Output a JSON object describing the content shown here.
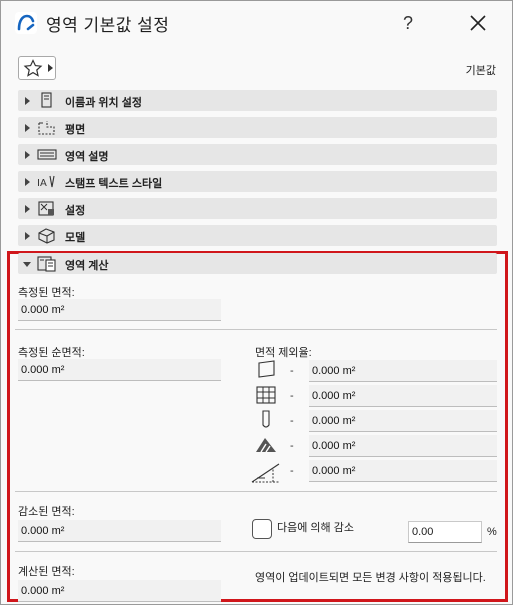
{
  "window": {
    "title": "영역 기본값 설정",
    "help_label": "?",
    "default_label": "기본값"
  },
  "favorites": {
    "icon": "star-icon"
  },
  "panels": [
    {
      "label": "이름과 위치 설정",
      "icon": "name-location-icon",
      "expanded": false
    },
    {
      "label": "평면",
      "icon": "floor-plan-icon",
      "expanded": false
    },
    {
      "label": "영역 설명",
      "icon": "description-icon",
      "expanded": false
    },
    {
      "label": "스탬프 텍스트 스타일",
      "icon": "stamp-text-icon",
      "expanded": false
    },
    {
      "label": "설정",
      "icon": "settings-icon",
      "expanded": false
    },
    {
      "label": "모델",
      "icon": "model-icon",
      "expanded": false
    },
    {
      "label": "영역 계산",
      "icon": "zone-calc-icon",
      "expanded": true
    }
  ],
  "calc": {
    "measured_label": "측정된 면적:",
    "measured_value": "0.000 m²",
    "net_label": "측정된 순면적:",
    "net_value": "0.000 m²",
    "deductions_label": "면적 제외율:",
    "deductions": [
      {
        "icon": "wall-icon",
        "dash": "-",
        "value": "0.000 m²"
      },
      {
        "icon": "column-grid-icon",
        "dash": "-",
        "value": "0.000 m²"
      },
      {
        "icon": "pillar-icon",
        "dash": "-",
        "value": "0.000 m²"
      },
      {
        "icon": "slanted-area-icon",
        "dash": "-",
        "value": "0.000 m²"
      },
      {
        "icon": "low-height-icon",
        "dash": "-",
        "value": "0.000 m²"
      }
    ],
    "reduced_label": "감소된 면적:",
    "reduced_value": "0.000 m²",
    "reduce_by_label": "다음에 의해 감소",
    "reduce_percent": "0.00",
    "percent_sign": "%",
    "calculated_label": "계산된 면적:",
    "calculated_value": "0.000 m²",
    "update_note": "영역이 업데이트되면 모든 변경 사항이 적용됩니다."
  },
  "colors": {
    "highlight": "#d0161b",
    "panel_header": "#e6e6e6"
  }
}
